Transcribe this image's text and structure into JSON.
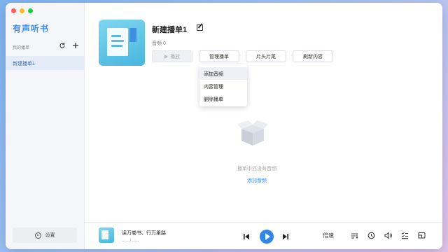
{
  "sidebar": {
    "app_title": "有声听书",
    "section_label": "我的播单",
    "refresh_icon": "refresh-icon",
    "add_icon": "plus-icon",
    "items": [
      {
        "label": "新建播单1"
      }
    ],
    "settings_label": "设置"
  },
  "playlist": {
    "title": "新建播单1",
    "count": "音频 0",
    "buttons": {
      "play": "播放",
      "manage": "管理播单",
      "trim": "片头片尾",
      "refresh": "刷新内容"
    },
    "menu": {
      "items": [
        {
          "label": "添加音频"
        },
        {
          "label": "内容管理"
        },
        {
          "label": "删除播单"
        }
      ]
    },
    "empty": {
      "message": "播单中还没有音频",
      "link": "添加音频"
    }
  },
  "player": {
    "track_title": "读万卷书、行万里路",
    "time": "--:-- / --:--",
    "speed_label": "倍速"
  },
  "colors": {
    "accent": "#2f86e9",
    "sidebar_bg": "#f4f6fa",
    "selected_bg": "#e4ecf8"
  }
}
